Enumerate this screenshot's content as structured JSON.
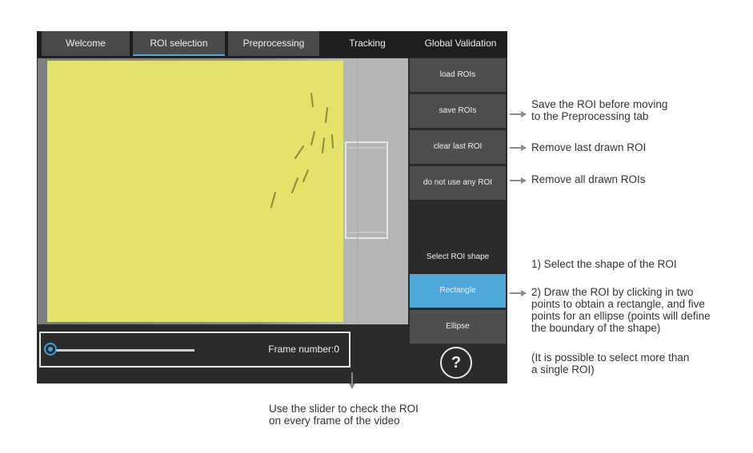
{
  "tabs": [
    {
      "label": "Welcome",
      "state": "inactive"
    },
    {
      "label": "ROI selection",
      "state": "active"
    },
    {
      "label": "Preprocessing",
      "state": "inactive"
    },
    {
      "label": "Tracking",
      "state": "dark"
    },
    {
      "label": "Global Validation",
      "state": "dark"
    }
  ],
  "sidebar": {
    "load_rois": "load ROIs",
    "save_rois": "save ROIs",
    "clear_last_roi": "clear last ROI",
    "do_not_use_any_roi": "do not use any ROI",
    "select_shape_label": "Select ROI shape",
    "rectangle": "Rectangle",
    "ellipse": "Ellipse",
    "help": "?"
  },
  "slider": {
    "frame_label": "Frame number:0",
    "position_fraction": 0
  },
  "annotations": {
    "save": "Save the ROI before moving\nto the Preprocessing tab",
    "clear": "Remove last drawn ROI",
    "none": "Remove all drawn ROIs",
    "shape1": "1) Select the shape of the ROI",
    "shape2": "2) Draw the ROI by clicking in two\npoints to obtain a rectangle, and five\npoints for an ellipse (points will define\nthe boundary of the shape)",
    "multi": "(It is possible to select more than\na single ROI)",
    "slider": "Use the slider to check the ROI\non every frame of the video"
  },
  "colors": {
    "accent": "#4fa6d8",
    "roi_fill": "#e3e36b",
    "panel": "#2b2b2b"
  }
}
